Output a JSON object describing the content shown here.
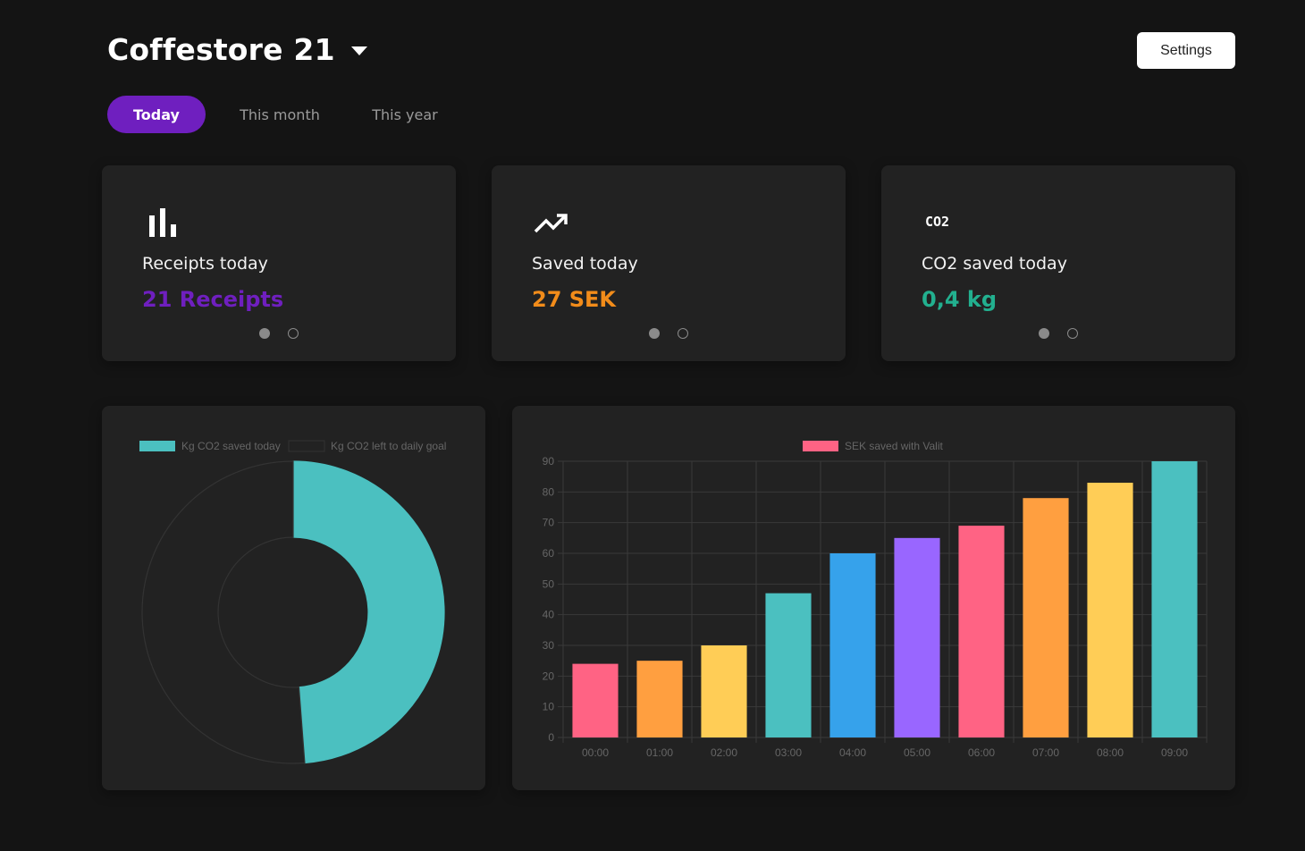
{
  "header": {
    "title": "Coffestore 21",
    "settings_label": "Settings"
  },
  "tabs": [
    {
      "label": "Today",
      "active": true
    },
    {
      "label": "This month",
      "active": false
    },
    {
      "label": "This year",
      "active": false
    }
  ],
  "cards": [
    {
      "icon": "bar-chart-icon",
      "label": "Receipts today",
      "value": "21 Receipts",
      "value_color": "#6f1fbf"
    },
    {
      "icon": "trending-up-icon",
      "label": "Saved today",
      "value": "27 SEK",
      "value_color": "#f28c1a"
    },
    {
      "icon": "co2-icon",
      "icon_text": "CO2",
      "label": "CO2 saved today",
      "value": "0,4 kg",
      "value_color": "#22b08f"
    }
  ],
  "chart_data": [
    {
      "type": "doughnut",
      "legend": [
        {
          "name": "Kg CO2 saved today",
          "color": "#4bc0c0"
        },
        {
          "name": "Kg CO2 left to daily goal",
          "color": "#222222"
        }
      ],
      "values": [
        0.4,
        0.42
      ],
      "legend_position": "top"
    },
    {
      "type": "bar",
      "legend": [
        {
          "name": "SEK saved with Valit",
          "color": "#ff6384"
        }
      ],
      "categories": [
        "00:00",
        "01:00",
        "02:00",
        "03:00",
        "04:00",
        "05:00",
        "06:00",
        "07:00",
        "08:00",
        "09:00"
      ],
      "series": [
        {
          "name": "SEK saved with Valit",
          "values": [
            24,
            25,
            30,
            47,
            60,
            65,
            69,
            78,
            83,
            90
          ]
        }
      ],
      "colors": [
        "#ff6384",
        "#ff9f40",
        "#ffcd56",
        "#4bc0c0",
        "#36a2eb",
        "#9966ff",
        "#ff6384",
        "#ff9f40",
        "#ffcd56",
        "#4bc0c0"
      ],
      "ylim": [
        0,
        90
      ],
      "yticks": [
        "0",
        "10",
        "20",
        "30",
        "40",
        "50",
        "60",
        "70",
        "80",
        "90"
      ],
      "grid": true,
      "legend_position": "top"
    }
  ]
}
